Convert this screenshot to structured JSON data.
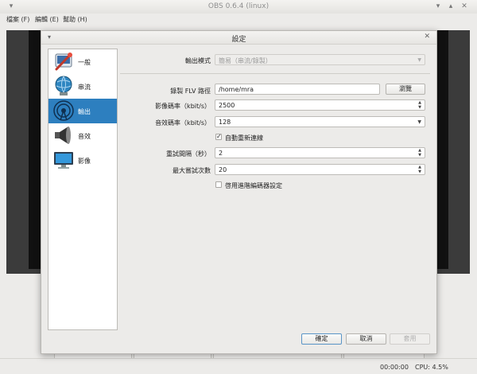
{
  "window": {
    "title": "OBS 0.6.4 (linux)",
    "controls": {
      "minimize": "▾",
      "maximize": "▴",
      "close": "✕"
    }
  },
  "menubar": [
    {
      "label": "檔案 (F)"
    },
    {
      "label": "編輯 (E)"
    },
    {
      "label": "幫助 (H)"
    }
  ],
  "statusbar": {
    "time": "00:00:00",
    "cpu": "CPU: 4.5%"
  },
  "dialog": {
    "title": "設定",
    "menu_glyph": "▾",
    "close_glyph": "✕",
    "sidebar": [
      {
        "label": "一般",
        "icon": "general-settings-icon",
        "selected": false
      },
      {
        "label": "串流",
        "icon": "stream-globe-icon",
        "selected": false
      },
      {
        "label": "輸出",
        "icon": "output-broadcast-icon",
        "selected": true
      },
      {
        "label": "音效",
        "icon": "speaker-icon",
        "selected": false
      },
      {
        "label": "影像",
        "icon": "monitor-icon",
        "selected": false
      }
    ],
    "output": {
      "mode_label": "輸出模式",
      "mode_value": "簡易（串流/錄製）",
      "path_label": "錄製 FLV 路徑",
      "path_value": "/home/mra",
      "browse_label": "瀏覽",
      "video_bitrate_label": "影像碼率（kbit/s）",
      "video_bitrate_value": "2500",
      "audio_bitrate_label": "音效碼率（kbit/s）",
      "audio_bitrate_value": "128",
      "auto_reconnect_label": "自動重新連線",
      "auto_reconnect_checked": true,
      "retry_delay_label": "重試間隔（秒）",
      "retry_delay_value": "2",
      "max_retries_label": "最大嘗試次數",
      "max_retries_value": "20",
      "advanced_encoder_label": "啓用進階編碼器設定",
      "advanced_encoder_checked": false
    },
    "buttons": {
      "ok": "確定",
      "cancel": "取消",
      "apply": "套用"
    }
  }
}
